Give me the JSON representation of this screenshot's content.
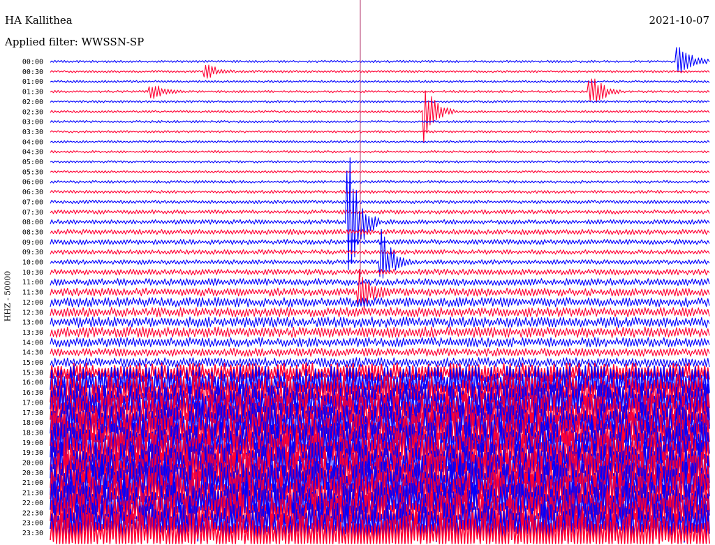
{
  "header": {
    "station": "HA Kallithea",
    "date": "2021-10-07",
    "filter": "Applied filter: WWSSN-SP",
    "channel": "HHZ - 50000"
  },
  "chart_data": {
    "type": "line",
    "title": "HA Kallithea",
    "subtitle": "Applied filter: WWSSN-SP",
    "ylabel": "HHZ - 50000",
    "colors": {
      "even_row": "#0000ff",
      "odd_row": "#ff0033",
      "marker": "#b0306a"
    },
    "row_minutes": 30,
    "tick_labels": [
      "00:00",
      "00:30",
      "01:00",
      "01:30",
      "02:00",
      "02:30",
      "03:00",
      "03:30",
      "04:00",
      "04:30",
      "05:00",
      "05:30",
      "06:00",
      "06:30",
      "07:00",
      "07:30",
      "08:00",
      "08:30",
      "09:00",
      "09:30",
      "10:00",
      "10:30",
      "11:00",
      "11:30",
      "12:00",
      "12:30",
      "13:00",
      "13:30",
      "14:00",
      "14:30",
      "15:00",
      "15:30",
      "16:00",
      "16:30",
      "17:00",
      "17:30",
      "18:00",
      "18:30",
      "19:00",
      "19:30",
      "20:00",
      "20:30",
      "21:00",
      "21:30",
      "22:00",
      "22:30",
      "23:00",
      "23:30"
    ],
    "noise_level": [
      1,
      1,
      1,
      1,
      1,
      1,
      1,
      1,
      1,
      1,
      1,
      1,
      1.2,
      1.3,
      1.5,
      1.8,
      2,
      2.2,
      2.2,
      2,
      2,
      2.5,
      3,
      3.5,
      4,
      4,
      4.5,
      4.5,
      4,
      3.5,
      4,
      8,
      14,
      15,
      16,
      16,
      17,
      17,
      18,
      18,
      18,
      18,
      18,
      18,
      18,
      17,
      17,
      17
    ],
    "events": [
      {
        "row": 0,
        "minute": 28.5,
        "amplitude": 28
      },
      {
        "row": 3,
        "minute": 24.5,
        "amplitude": 26
      },
      {
        "row": 5,
        "minute": 17,
        "amplitude": 30
      },
      {
        "row": 20,
        "minute": 15,
        "amplitude": 35
      },
      {
        "row": 23,
        "minute": 14,
        "amplitude": 28
      },
      {
        "row": 1,
        "minute": 7,
        "amplitude": 10
      },
      {
        "row": 3,
        "minute": 4.5,
        "amplitude": 12
      },
      {
        "row": 16,
        "minute": 13.5,
        "amplitude": 90
      }
    ]
  }
}
